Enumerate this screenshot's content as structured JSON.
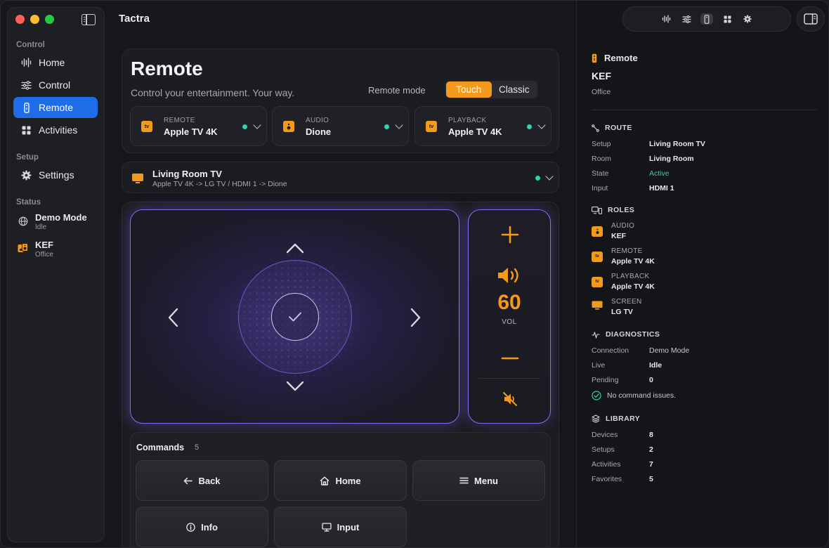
{
  "app": {
    "title": "Tactra"
  },
  "sidebar": {
    "sections": {
      "control": "Control",
      "setup": "Setup",
      "status": "Status"
    },
    "items": [
      {
        "label": "Home",
        "icon": "waveform-icon"
      },
      {
        "label": "Control",
        "icon": "sliders-icon"
      },
      {
        "label": "Remote",
        "icon": "remote-icon",
        "active": true
      },
      {
        "label": "Activities",
        "icon": "grid-icon"
      }
    ],
    "settings": {
      "label": "Settings",
      "icon": "gear-icon"
    },
    "status": [
      {
        "title": "Demo Mode",
        "sub": "Idle",
        "icon": "globe-icon"
      },
      {
        "title": "KEF",
        "sub": "Office",
        "icon": "speaker-icon"
      }
    ]
  },
  "hero": {
    "title": "Remote",
    "subtitle": "Control your entertainment. Your way.",
    "mode_label": "Remote mode",
    "modes": [
      "Touch",
      "Classic"
    ],
    "selected_mode": "Touch"
  },
  "roles": [
    {
      "kicker": "REMOTE",
      "name": "Apple TV 4K",
      "icon_text": "tv"
    },
    {
      "kicker": "AUDIO",
      "name": "Dione",
      "icon_text": ""
    },
    {
      "kicker": "PLAYBACK",
      "name": "Apple TV 4K",
      "icon_text": "tv"
    }
  ],
  "route_bar": {
    "title": "Living Room TV",
    "path": "Apple TV 4K -> LG TV / HDMI 1 -> Dione"
  },
  "volume": {
    "value": "60",
    "label": "VOL"
  },
  "commands": {
    "title": "Commands",
    "count": "5",
    "buttons": [
      {
        "label": "Back",
        "icon": "arrow-left-icon"
      },
      {
        "label": "Home",
        "icon": "house-icon"
      },
      {
        "label": "Menu",
        "icon": "menu-icon"
      },
      {
        "label": "Info",
        "icon": "info-icon"
      },
      {
        "label": "Input",
        "icon": "display-icon"
      }
    ]
  },
  "inspector": {
    "header": "Remote",
    "device": "KEF",
    "room": "Office",
    "route": {
      "title": "ROUTE",
      "rows": [
        {
          "k": "Setup",
          "v": "Living Room TV"
        },
        {
          "k": "Room",
          "v": "Living Room"
        },
        {
          "k": "State",
          "v": "Active"
        },
        {
          "k": "Input",
          "v": "HDMI 1"
        }
      ]
    },
    "roles": {
      "title": "ROLES",
      "rows": [
        {
          "k": "AUDIO",
          "v": "KEF"
        },
        {
          "k": "REMOTE",
          "v": "Apple TV 4K"
        },
        {
          "k": "PLAYBACK",
          "v": "Apple TV 4K"
        },
        {
          "k": "SCREEN",
          "v": "LG TV"
        }
      ]
    },
    "diagnostics": {
      "title": "DIAGNOSTICS",
      "rows": [
        {
          "k": "Connection",
          "v": "Demo Mode"
        },
        {
          "k": "Live",
          "v": "Idle"
        },
        {
          "k": "Pending",
          "v": "0"
        }
      ],
      "ok": "No command issues."
    },
    "library": {
      "title": "LIBRARY",
      "rows": [
        {
          "k": "Devices",
          "v": "8"
        },
        {
          "k": "Setups",
          "v": "2"
        },
        {
          "k": "Activities",
          "v": "7"
        },
        {
          "k": "Favorites",
          "v": "5"
        }
      ]
    }
  },
  "colors": {
    "accent": "#f39a1c",
    "selection": "#1f6ce8",
    "touch_border": "#8a6bf0",
    "status_ok": "#2fd1b0"
  }
}
